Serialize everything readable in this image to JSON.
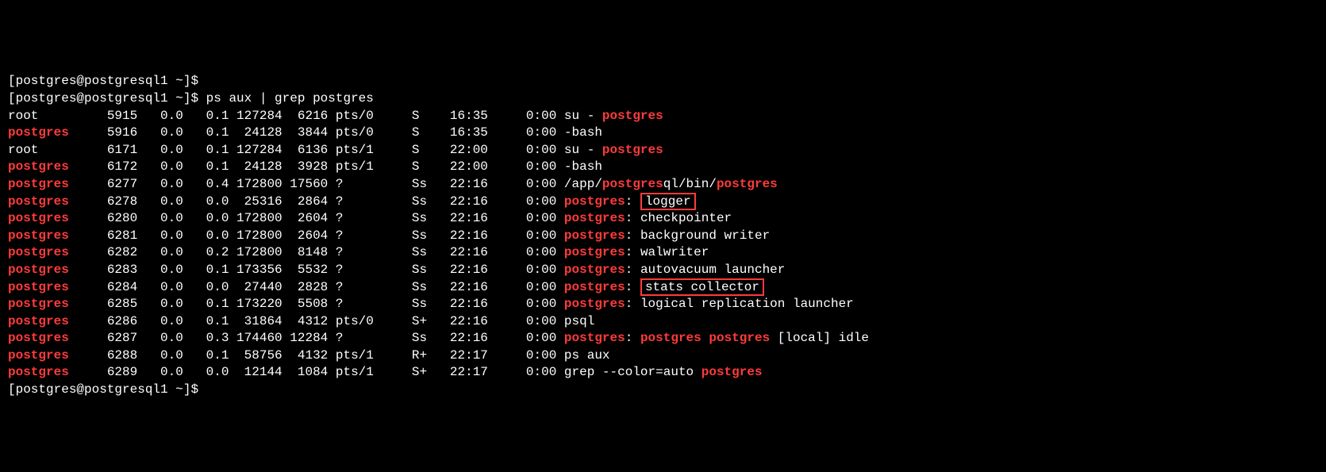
{
  "prompt": {
    "user": "postgres",
    "host": "postgresql1",
    "path": "~",
    "sigil": "$"
  },
  "command": "ps aux | grep postgres",
  "hlword": "postgres",
  "rows": [
    {
      "user": "root",
      "pid": "5915",
      "cpu": "0.0",
      "mem": "0.1",
      "vsz": "127284",
      "rss": "6216",
      "tty": "pts/0",
      "stat": "S",
      "start": "16:35",
      "time": "0:00",
      "cmd": [
        {
          "t": "su - "
        },
        {
          "t": "postgres",
          "hl": true
        }
      ]
    },
    {
      "user": "postgres",
      "pid": "5916",
      "cpu": "0.0",
      "mem": "0.1",
      "vsz": "24128",
      "rss": "3844",
      "tty": "pts/0",
      "stat": "S",
      "start": "16:35",
      "time": "0:00",
      "cmd": [
        {
          "t": "-bash"
        }
      ]
    },
    {
      "user": "root",
      "pid": "6171",
      "cpu": "0.0",
      "mem": "0.1",
      "vsz": "127284",
      "rss": "6136",
      "tty": "pts/1",
      "stat": "S",
      "start": "22:00",
      "time": "0:00",
      "cmd": [
        {
          "t": "su - "
        },
        {
          "t": "postgres",
          "hl": true
        }
      ]
    },
    {
      "user": "postgres",
      "pid": "6172",
      "cpu": "0.0",
      "mem": "0.1",
      "vsz": "24128",
      "rss": "3928",
      "tty": "pts/1",
      "stat": "S",
      "start": "22:00",
      "time": "0:00",
      "cmd": [
        {
          "t": "-bash"
        }
      ]
    },
    {
      "user": "postgres",
      "pid": "6277",
      "cpu": "0.0",
      "mem": "0.4",
      "vsz": "172800",
      "rss": "17560",
      "tty": "?",
      "stat": "Ss",
      "start": "22:16",
      "time": "0:00",
      "cmd": [
        {
          "t": "/app/"
        },
        {
          "t": "postgres",
          "hl": true
        },
        {
          "t": "ql/bin/"
        },
        {
          "t": "postgres",
          "hl": true
        }
      ]
    },
    {
      "user": "postgres",
      "pid": "6278",
      "cpu": "0.0",
      "mem": "0.0",
      "vsz": "25316",
      "rss": "2864",
      "tty": "?",
      "stat": "Ss",
      "start": "22:16",
      "time": "0:00",
      "cmd": [
        {
          "t": "postgres",
          "hl": true
        },
        {
          "t": ": "
        },
        {
          "t": "logger",
          "box": true
        }
      ]
    },
    {
      "user": "postgres",
      "pid": "6280",
      "cpu": "0.0",
      "mem": "0.0",
      "vsz": "172800",
      "rss": "2604",
      "tty": "?",
      "stat": "Ss",
      "start": "22:16",
      "time": "0:00",
      "cmd": [
        {
          "t": "postgres",
          "hl": true
        },
        {
          "t": ": checkpointer"
        }
      ]
    },
    {
      "user": "postgres",
      "pid": "6281",
      "cpu": "0.0",
      "mem": "0.0",
      "vsz": "172800",
      "rss": "2604",
      "tty": "?",
      "stat": "Ss",
      "start": "22:16",
      "time": "0:00",
      "cmd": [
        {
          "t": "postgres",
          "hl": true
        },
        {
          "t": ": background writer"
        }
      ]
    },
    {
      "user": "postgres",
      "pid": "6282",
      "cpu": "0.0",
      "mem": "0.2",
      "vsz": "172800",
      "rss": "8148",
      "tty": "?",
      "stat": "Ss",
      "start": "22:16",
      "time": "0:00",
      "cmd": [
        {
          "t": "postgres",
          "hl": true
        },
        {
          "t": ": walwriter"
        }
      ]
    },
    {
      "user": "postgres",
      "pid": "6283",
      "cpu": "0.0",
      "mem": "0.1",
      "vsz": "173356",
      "rss": "5532",
      "tty": "?",
      "stat": "Ss",
      "start": "22:16",
      "time": "0:00",
      "cmd": [
        {
          "t": "postgres",
          "hl": true
        },
        {
          "t": ": autovacuum launcher"
        }
      ]
    },
    {
      "user": "postgres",
      "pid": "6284",
      "cpu": "0.0",
      "mem": "0.0",
      "vsz": "27440",
      "rss": "2828",
      "tty": "?",
      "stat": "Ss",
      "start": "22:16",
      "time": "0:00",
      "cmd": [
        {
          "t": "postgres",
          "hl": true
        },
        {
          "t": ": "
        },
        {
          "t": "stats collector",
          "box": true
        }
      ]
    },
    {
      "user": "postgres",
      "pid": "6285",
      "cpu": "0.0",
      "mem": "0.1",
      "vsz": "173220",
      "rss": "5508",
      "tty": "?",
      "stat": "Ss",
      "start": "22:16",
      "time": "0:00",
      "cmd": [
        {
          "t": "postgres",
          "hl": true
        },
        {
          "t": ": logical replication launcher"
        }
      ]
    },
    {
      "user": "postgres",
      "pid": "6286",
      "cpu": "0.0",
      "mem": "0.1",
      "vsz": "31864",
      "rss": "4312",
      "tty": "pts/0",
      "stat": "S+",
      "start": "22:16",
      "time": "0:00",
      "cmd": [
        {
          "t": "psql"
        }
      ]
    },
    {
      "user": "postgres",
      "pid": "6287",
      "cpu": "0.0",
      "mem": "0.3",
      "vsz": "174460",
      "rss": "12284",
      "tty": "?",
      "stat": "Ss",
      "start": "22:16",
      "time": "0:00",
      "cmd": [
        {
          "t": "postgres",
          "hl": true
        },
        {
          "t": ": "
        },
        {
          "t": "postgres",
          "hl": true
        },
        {
          "t": " "
        },
        {
          "t": "postgres",
          "hl": true
        },
        {
          "t": " [local] idle"
        }
      ]
    },
    {
      "user": "postgres",
      "pid": "6288",
      "cpu": "0.0",
      "mem": "0.1",
      "vsz": "58756",
      "rss": "4132",
      "tty": "pts/1",
      "stat": "R+",
      "start": "22:17",
      "time": "0:00",
      "cmd": [
        {
          "t": "ps aux"
        }
      ]
    },
    {
      "user": "postgres",
      "pid": "6289",
      "cpu": "0.0",
      "mem": "0.0",
      "vsz": "12144",
      "rss": "1084",
      "tty": "pts/1",
      "stat": "S+",
      "start": "22:17",
      "time": "0:00",
      "cmd": [
        {
          "t": "grep --color=auto "
        },
        {
          "t": "postgres",
          "hl": true
        }
      ]
    }
  ],
  "widths": {
    "user": 9,
    "pid": 8,
    "cpu": 6,
    "mem": 6,
    "vsz": 7,
    "rss": 6,
    "tty": 10,
    "stat": 5,
    "start": 10,
    "time": 5
  }
}
